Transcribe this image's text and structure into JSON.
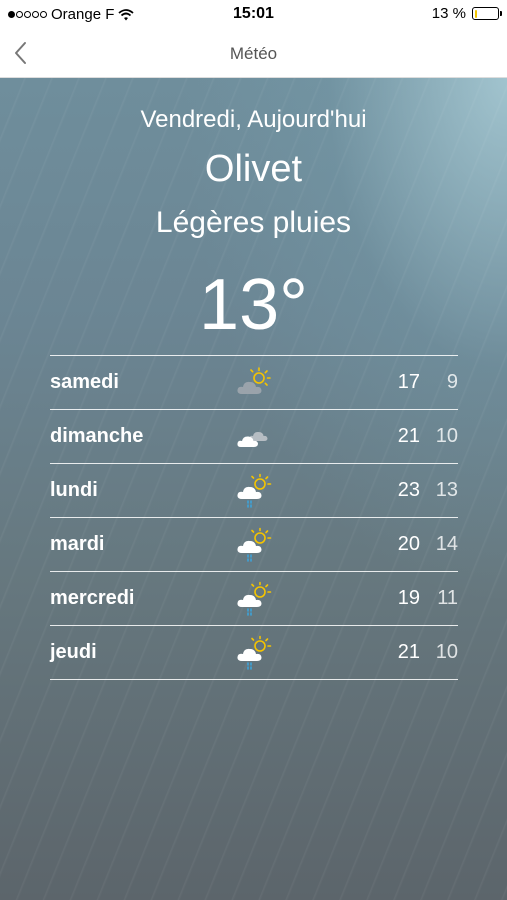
{
  "status_bar": {
    "carrier": "Orange F",
    "time": "15:01",
    "battery": "13 %",
    "battery_level": 0.13
  },
  "nav": {
    "title": "Météo",
    "back_icon": "chevron-left-icon"
  },
  "weather": {
    "day": "Vendredi, Aujourd'hui",
    "city": "Olivet",
    "condition": "Légères pluies",
    "temperature": "13°"
  },
  "forecast": [
    {
      "day": "samedi",
      "icon": "sun-cloud-icon",
      "high": "17",
      "low": "9"
    },
    {
      "day": "dimanche",
      "icon": "cloudy-icon",
      "high": "21",
      "low": "10"
    },
    {
      "day": "lundi",
      "icon": "sun-cloud-rain-icon",
      "high": "23",
      "low": "13"
    },
    {
      "day": "mardi",
      "icon": "sun-cloud-rain-icon",
      "high": "20",
      "low": "14"
    },
    {
      "day": "mercredi",
      "icon": "sun-cloud-rain-icon",
      "high": "19",
      "low": "11"
    },
    {
      "day": "jeudi",
      "icon": "sun-cloud-rain-icon",
      "high": "21",
      "low": "10"
    }
  ],
  "colors": {
    "sun": "#f5c400",
    "rain": "#3aa6e0",
    "battery": "#f2c500"
  }
}
